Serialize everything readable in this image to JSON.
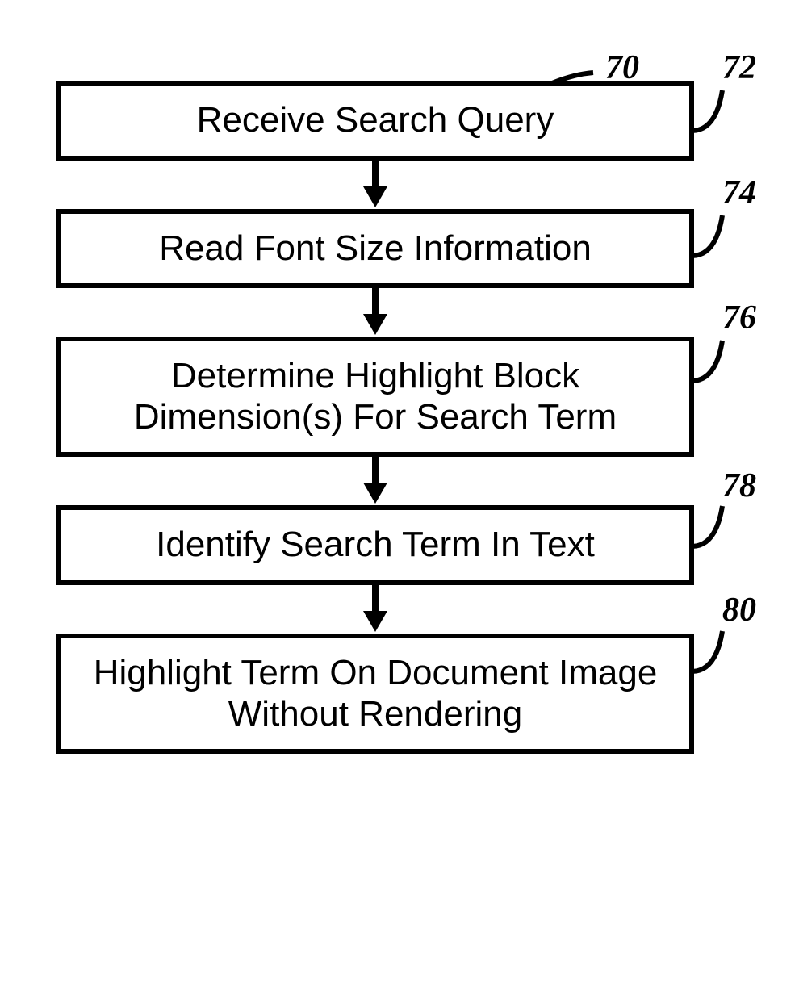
{
  "diagram": {
    "reference": "70",
    "steps": [
      {
        "label": "Receive Search Query",
        "ref": "72"
      },
      {
        "label": "Read Font Size Information",
        "ref": "74"
      },
      {
        "label": "Determine Highlight Block Dimension(s) For Search Term",
        "ref": "76"
      },
      {
        "label": "Identify Search Term In Text",
        "ref": "78"
      },
      {
        "label": "Highlight Term On Document Image Without Rendering",
        "ref": "80"
      }
    ]
  }
}
